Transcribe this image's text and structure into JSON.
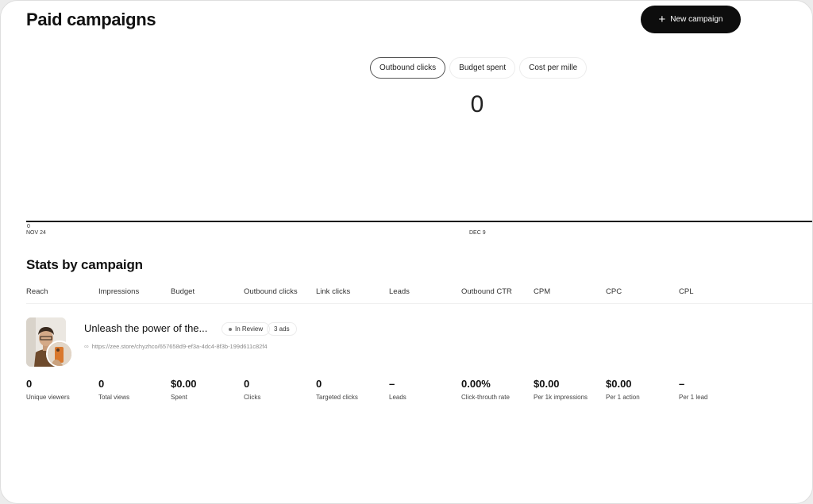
{
  "header": {
    "title": "Paid campaigns",
    "new_campaign_label": "New campaign"
  },
  "chart": {
    "tabs": [
      {
        "label": "Outbound clicks",
        "active": true
      },
      {
        "label": "Budget spent",
        "active": false
      },
      {
        "label": "Cost per mille",
        "active": false
      }
    ],
    "current_value": "0",
    "y_tick": "0",
    "x_ticks": [
      "NOV 24",
      "DEC 9"
    ]
  },
  "chart_data": {
    "type": "line",
    "x": [
      "NOV 24",
      "DEC 9"
    ],
    "series": [
      {
        "values": [
          0,
          0
        ]
      }
    ],
    "ylim": [
      0,
      0
    ]
  },
  "stats": {
    "title": "Stats by campaign",
    "columns": [
      "Reach",
      "Impressions",
      "Budget",
      "Outbound clicks",
      "Link clicks",
      "Leads",
      "Outbound CTR",
      "CPM",
      "CPC",
      "CPL"
    ],
    "campaign": {
      "name": "Unleash the power of the...",
      "status": "In Review",
      "ads_count": "3 ads",
      "url": "https://zee.store/chyzhco/657658d9-ef3a-4dc4-8f3b-199d611c82f4",
      "metrics": [
        {
          "value": "0",
          "label": "Unique viewers"
        },
        {
          "value": "0",
          "label": "Total views"
        },
        {
          "value": "$0.00",
          "label": "Spent"
        },
        {
          "value": "0",
          "label": "Clicks"
        },
        {
          "value": "0",
          "label": "Targeted clicks"
        },
        {
          "value": "–",
          "label": "Leads"
        },
        {
          "value": "0.00%",
          "label": "Click-throuth rate"
        },
        {
          "value": "$0.00",
          "label": "Per 1k impressions"
        },
        {
          "value": "$0.00",
          "label": "Per 1 action"
        },
        {
          "value": "–",
          "label": "Per 1 lead"
        }
      ]
    }
  },
  "icons": {
    "new_campaign": "plus-icon",
    "status": "status-dot-icon",
    "link": "link-icon"
  }
}
